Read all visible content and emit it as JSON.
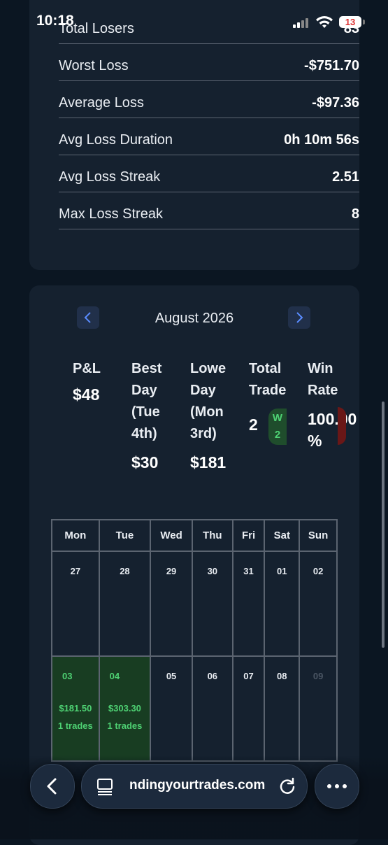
{
  "status_bar": {
    "time": "10:18",
    "battery": "13"
  },
  "loss_stats": [
    {
      "label": "Total Losers",
      "value": "83"
    },
    {
      "label": "Worst Loss",
      "value": "-$751.70"
    },
    {
      "label": "Average Loss",
      "value": "-$97.36"
    },
    {
      "label": "Avg Loss Duration",
      "value": "0h 10m 56s"
    },
    {
      "label": "Avg Loss Streak",
      "value": "2.51"
    },
    {
      "label": "Max Loss Streak",
      "value": "8"
    }
  ],
  "calendar": {
    "month": "August 2026",
    "summary": {
      "pnl_label": "P&L",
      "pnl_value": "$48",
      "best_label_1": "Best",
      "best_label_2": "Day",
      "best_label_3": "(Tue",
      "best_label_4": "4th)",
      "best_value": "$30",
      "lowest_label_1": "Lowe",
      "lowest_label_2": "Day",
      "lowest_label_3": "(Mon",
      "lowest_label_4": "3rd)",
      "lowest_value": "$181",
      "total_label_1": "Total",
      "total_label_2": "Trade",
      "total_value": "2",
      "pill_w": "W",
      "pill_n": "2",
      "win_label_1": "Win",
      "win_label_2": "Rate",
      "win_value_1": "100.00",
      "win_value_2": "%"
    },
    "weekdays": [
      "Mon",
      "Tue",
      "Wed",
      "Thu",
      "Fri",
      "Sat",
      "Sun"
    ],
    "week1": [
      "27",
      "28",
      "29",
      "30",
      "31",
      "01",
      "02"
    ],
    "week2": [
      {
        "day": "03",
        "pnl": "$181.50",
        "trades": "1 trades"
      },
      {
        "day": "04",
        "pnl": "$303.30",
        "trades": "1 trades"
      },
      {
        "day": "05"
      },
      {
        "day": "06"
      },
      {
        "day": "07"
      },
      {
        "day": "08"
      },
      {
        "day": "09"
      }
    ]
  },
  "browser": {
    "url": "ndingyourtrades.com"
  }
}
